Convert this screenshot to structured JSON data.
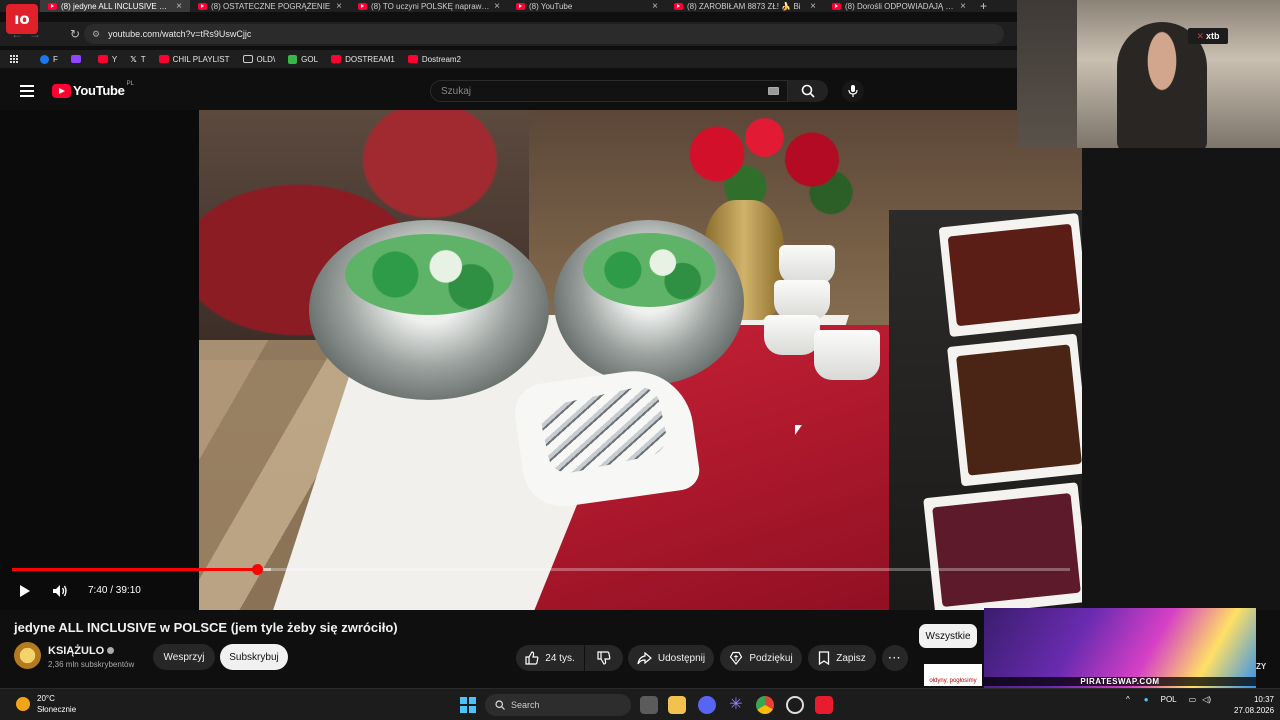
{
  "browser": {
    "tabs": [
      {
        "title": "(8) jedyne ALL INCLUSIVE w PO",
        "active": true
      },
      {
        "title": "(8) OSTATECZNE POGRĄŻENIE",
        "active": false
      },
      {
        "title": "(8) TO uczyni POLSKĘ naprawdę",
        "active": false
      },
      {
        "title": "(8) YouTube",
        "active": false
      },
      {
        "title": "(8) ZAROBIŁAM 8873 ZŁ! 🍌 Bi",
        "active": false
      },
      {
        "title": "(8) Dorośli ODPOWIADAJĄ na p",
        "active": false
      }
    ],
    "url": "youtube.com/watch?v=tRs9UswCjjc",
    "bookmarks": [
      {
        "label": "F",
        "color": "#1877f2"
      },
      {
        "label": "",
        "color": "#9146ff"
      },
      {
        "label": "Y",
        "color": "#ff0033"
      },
      {
        "label": "T",
        "color": "#ffffff"
      },
      {
        "label": "CHIL PLAYLIST",
        "color": "#ff0033"
      },
      {
        "label": "OLD\\",
        "color": "#cccccc"
      },
      {
        "label": "GOL",
        "color": "#3ab54a"
      },
      {
        "label": "DOSTREAM1",
        "color": "#ff0033"
      },
      {
        "label": "Dostream2",
        "color": "#ff0033"
      }
    ]
  },
  "youtube": {
    "logo_text": "YouTube",
    "logo_country": "PL",
    "search_placeholder": "Szukaj"
  },
  "player": {
    "time": "7:40 / 39:10",
    "progress_played": 0.232,
    "progress_loaded": 0.245
  },
  "video": {
    "title": "jedyne ALL INCLUSIVE w POLSCE (jem tyle żeby się zwróciło)",
    "channel_name": "KSIĄŻULO",
    "subscribers": "2,36 mln subskrybentów",
    "support_label": "Wesprzyj",
    "subscribe_label": "Subskrybuj",
    "likes": "24 tys.",
    "share_label": "Udostępnij",
    "thanks_label": "Podziękuj",
    "save_label": "Zapisz"
  },
  "sidebar": {
    "chip_all": "Wszystkie"
  },
  "overlay": {
    "xtb_label": "xtb",
    "ad_text": "PIRATESWAP.COM",
    "ad_small_text": "ołdyny, pogłosimy",
    "edge_text": "ZY"
  },
  "taskbar": {
    "temperature": "20°C",
    "weather": "Słonecznie",
    "search_label": "Search",
    "language": "POL",
    "time": "10:37",
    "date": "27.08.2026"
  },
  "colors": {
    "accent_red": "#ff0000",
    "background": "#0f0f0f"
  }
}
